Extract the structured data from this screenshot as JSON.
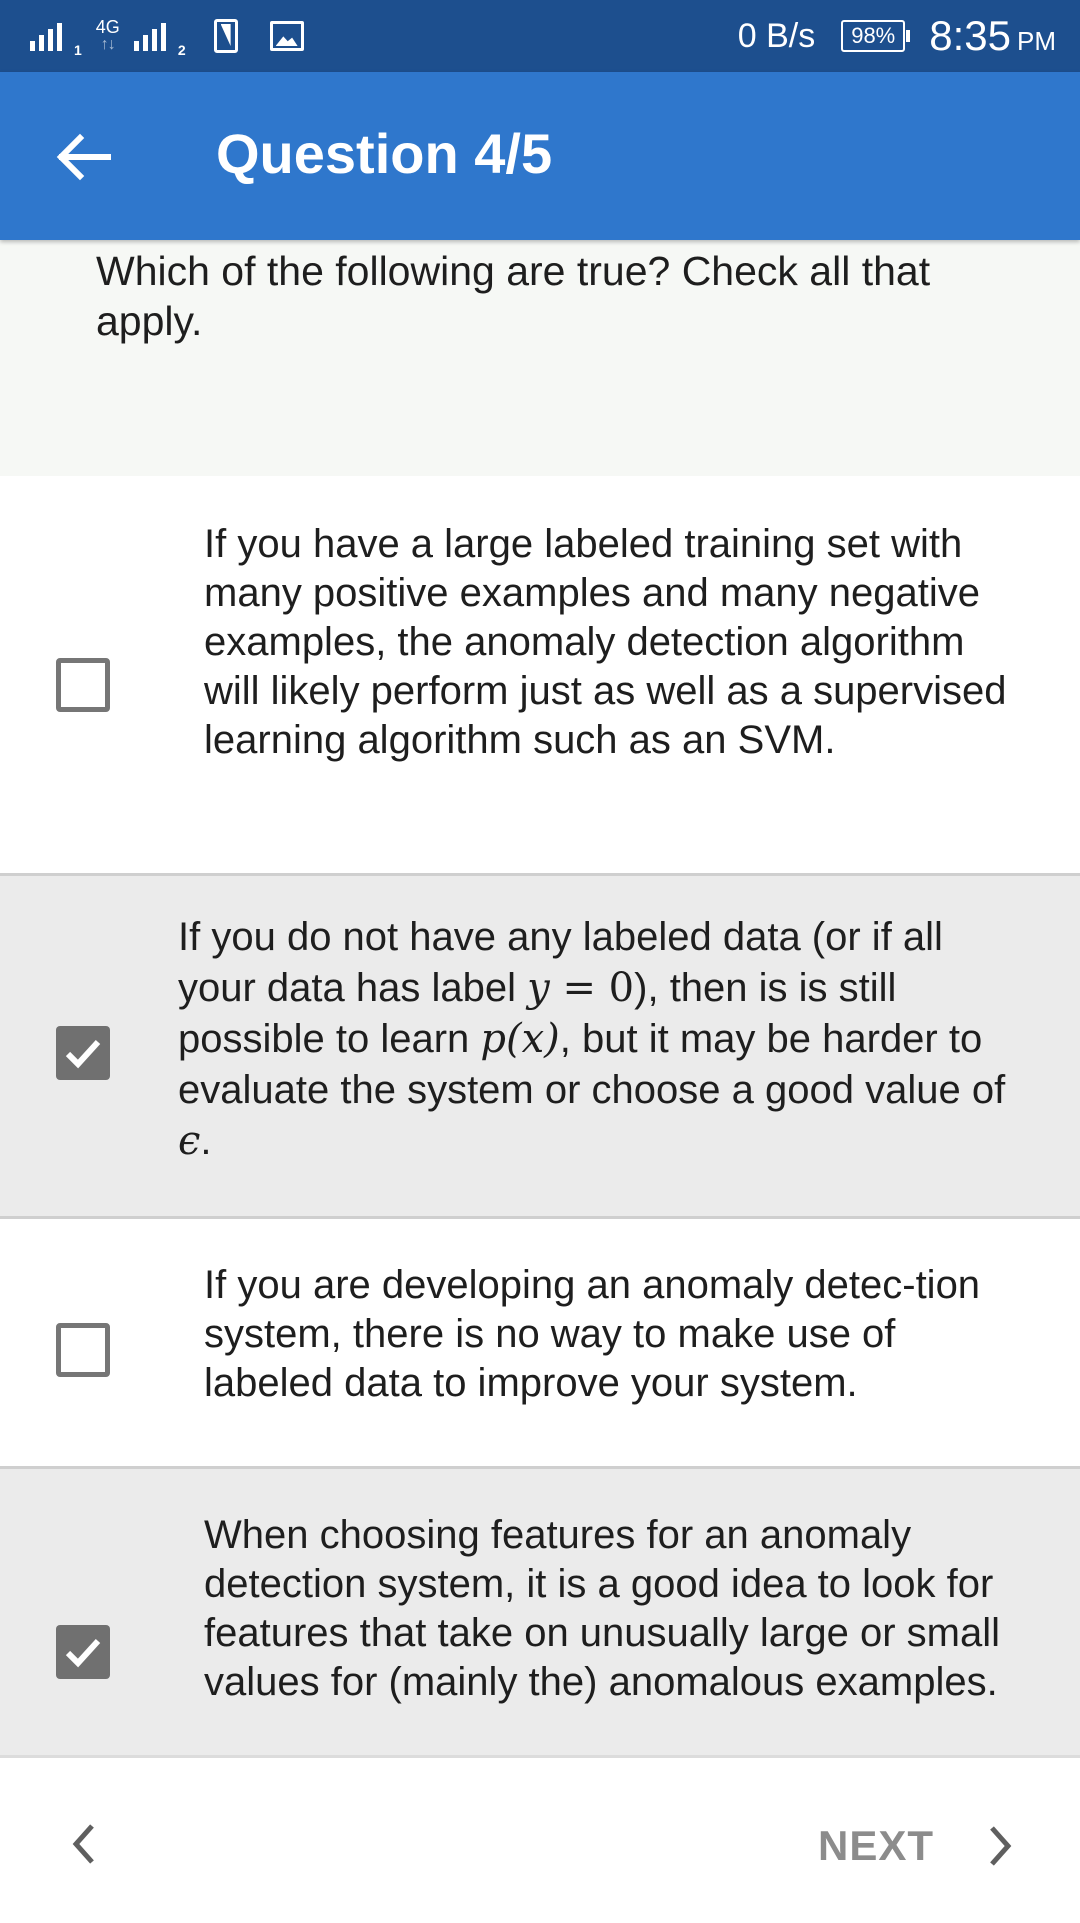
{
  "status_bar": {
    "network": "4G",
    "sim1_label": "1",
    "sim2_label": "2",
    "speed": "0 B/s",
    "battery": "98%",
    "time": "8:35",
    "ampm": "PM"
  },
  "app_bar": {
    "title": "Question 4/5",
    "back_icon": "arrow-left-icon"
  },
  "question": {
    "text": "Which of the following are true? Check all that apply."
  },
  "options": [
    {
      "checked": false,
      "text": "If you have a large labeled training set with many positive examples and many negative examples, the anomaly detection algorithm will likely perform just as well as a supervised learning algorithm such as an SVM."
    },
    {
      "checked": true,
      "text_before_y": "If you do not have any labeled data (or if all your data has label ",
      "math_y": "y",
      "math_eq": " = 0",
      "text_after_y": "), then is is still possible to learn ",
      "math_px": "p(x)",
      "text_after_px": ", but it may be harder to evaluate the system or choose a good value of ",
      "math_eps": "ϵ",
      "text_end": "."
    },
    {
      "checked": false,
      "text": "If you are developing an anomaly detec-tion system, there is no way to make use of labeled data to improve your system."
    },
    {
      "checked": true,
      "text": "When choosing features for an anomaly detection system, it is a good idea to look for features that take on unusually large or small values for (mainly the) anomalous examples."
    }
  ],
  "bottom_nav": {
    "prev_icon": "chevron-left-icon",
    "next_label": "NEXT",
    "next_icon": "chevron-right-icon"
  },
  "colors": {
    "status_bar": "#1d4f8e",
    "app_bar": "#2f77cc",
    "checked_bg": "#ebebeb",
    "checkbox": "#707070",
    "next_text": "#8c8c8c"
  }
}
